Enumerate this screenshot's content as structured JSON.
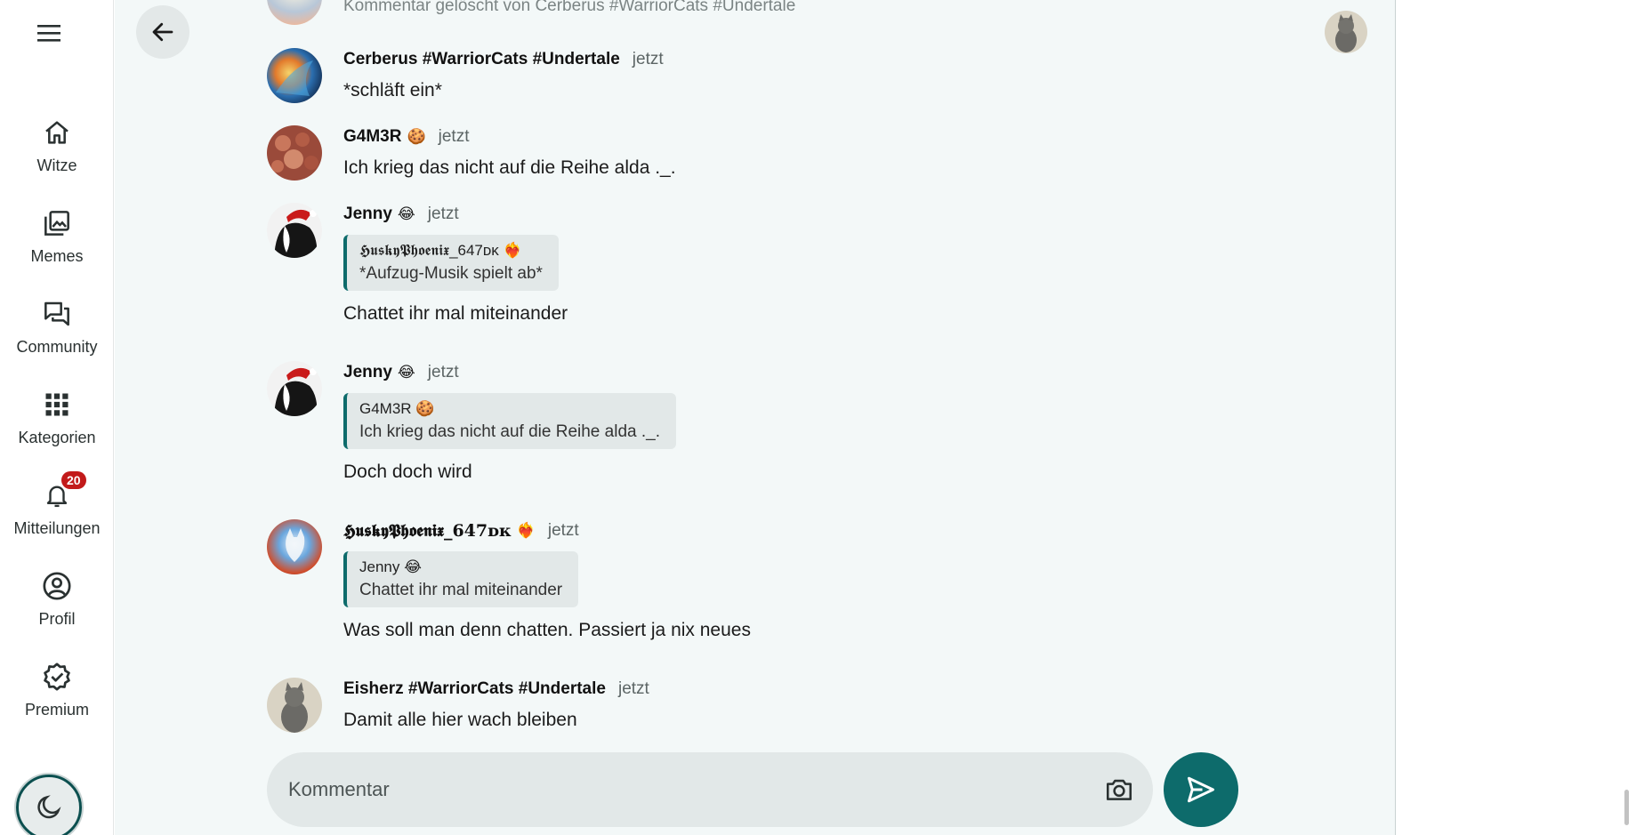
{
  "nav": {
    "items": [
      {
        "label": "Witze",
        "icon": "home-icon"
      },
      {
        "label": "Memes",
        "icon": "gallery-icon"
      },
      {
        "label": "Community",
        "icon": "chat-bubbles-icon"
      },
      {
        "label": "Kategorien",
        "icon": "grid-icon"
      },
      {
        "label": "Mitteilungen",
        "icon": "bell-icon",
        "badge": "20"
      },
      {
        "label": "Profil",
        "icon": "account-circle-icon"
      },
      {
        "label": "Premium",
        "icon": "verified-badge-icon"
      }
    ]
  },
  "chat": {
    "ghost_text": "Kommentar gelöscht von Cerberus #WarriorCats #Undertale",
    "messages": [
      {
        "name": "Cerberus #WarriorCats #Undertale",
        "time": "jetzt",
        "text": "*schläft ein*"
      },
      {
        "name": "G4M3R",
        "emoji": "🍪",
        "time": "jetzt",
        "text": "Ich krieg das nicht auf die Reihe alda ._."
      },
      {
        "name": "Jenny",
        "emoji": "😂",
        "time": "jetzt",
        "quote_name": "𝕳𝖚𝖘𝖐𝖞𝕻𝖍𝖔𝖊𝖓𝖎𝖝_647ᴅᴋ",
        "quote_emoji": "❤️‍🔥",
        "quote_text": "*Aufzug-Musik spielt ab*",
        "text": "Chattet ihr mal miteinander"
      },
      {
        "name": "Jenny",
        "emoji": "😂",
        "time": "jetzt",
        "quote_name": "G4M3R",
        "quote_emoji": "🍪",
        "quote_text": "Ich krieg das nicht auf die Reihe alda ._.",
        "text": "Doch doch wird"
      },
      {
        "name": "𝕳𝖚𝖘𝖐𝖞𝕻𝖍𝖔𝖊𝖓𝖎𝖝_647ᴅᴋ",
        "emoji": "❤️‍🔥",
        "time": "jetzt",
        "quote_name": "Jenny",
        "quote_emoji": "😂",
        "quote_text": "Chattet ihr mal miteinander",
        "text": "Was soll man denn chatten. Passiert ja nix neues"
      },
      {
        "name": "Eisherz #WarriorCats #Undertale",
        "time": "jetzt",
        "text": "Damit alle hier wach bleiben"
      }
    ]
  },
  "composer": {
    "placeholder": "Kommentar"
  },
  "colors": {
    "accent": "#0d6b6b",
    "badge": "#c21a1a",
    "background": "#f3f8f8"
  }
}
